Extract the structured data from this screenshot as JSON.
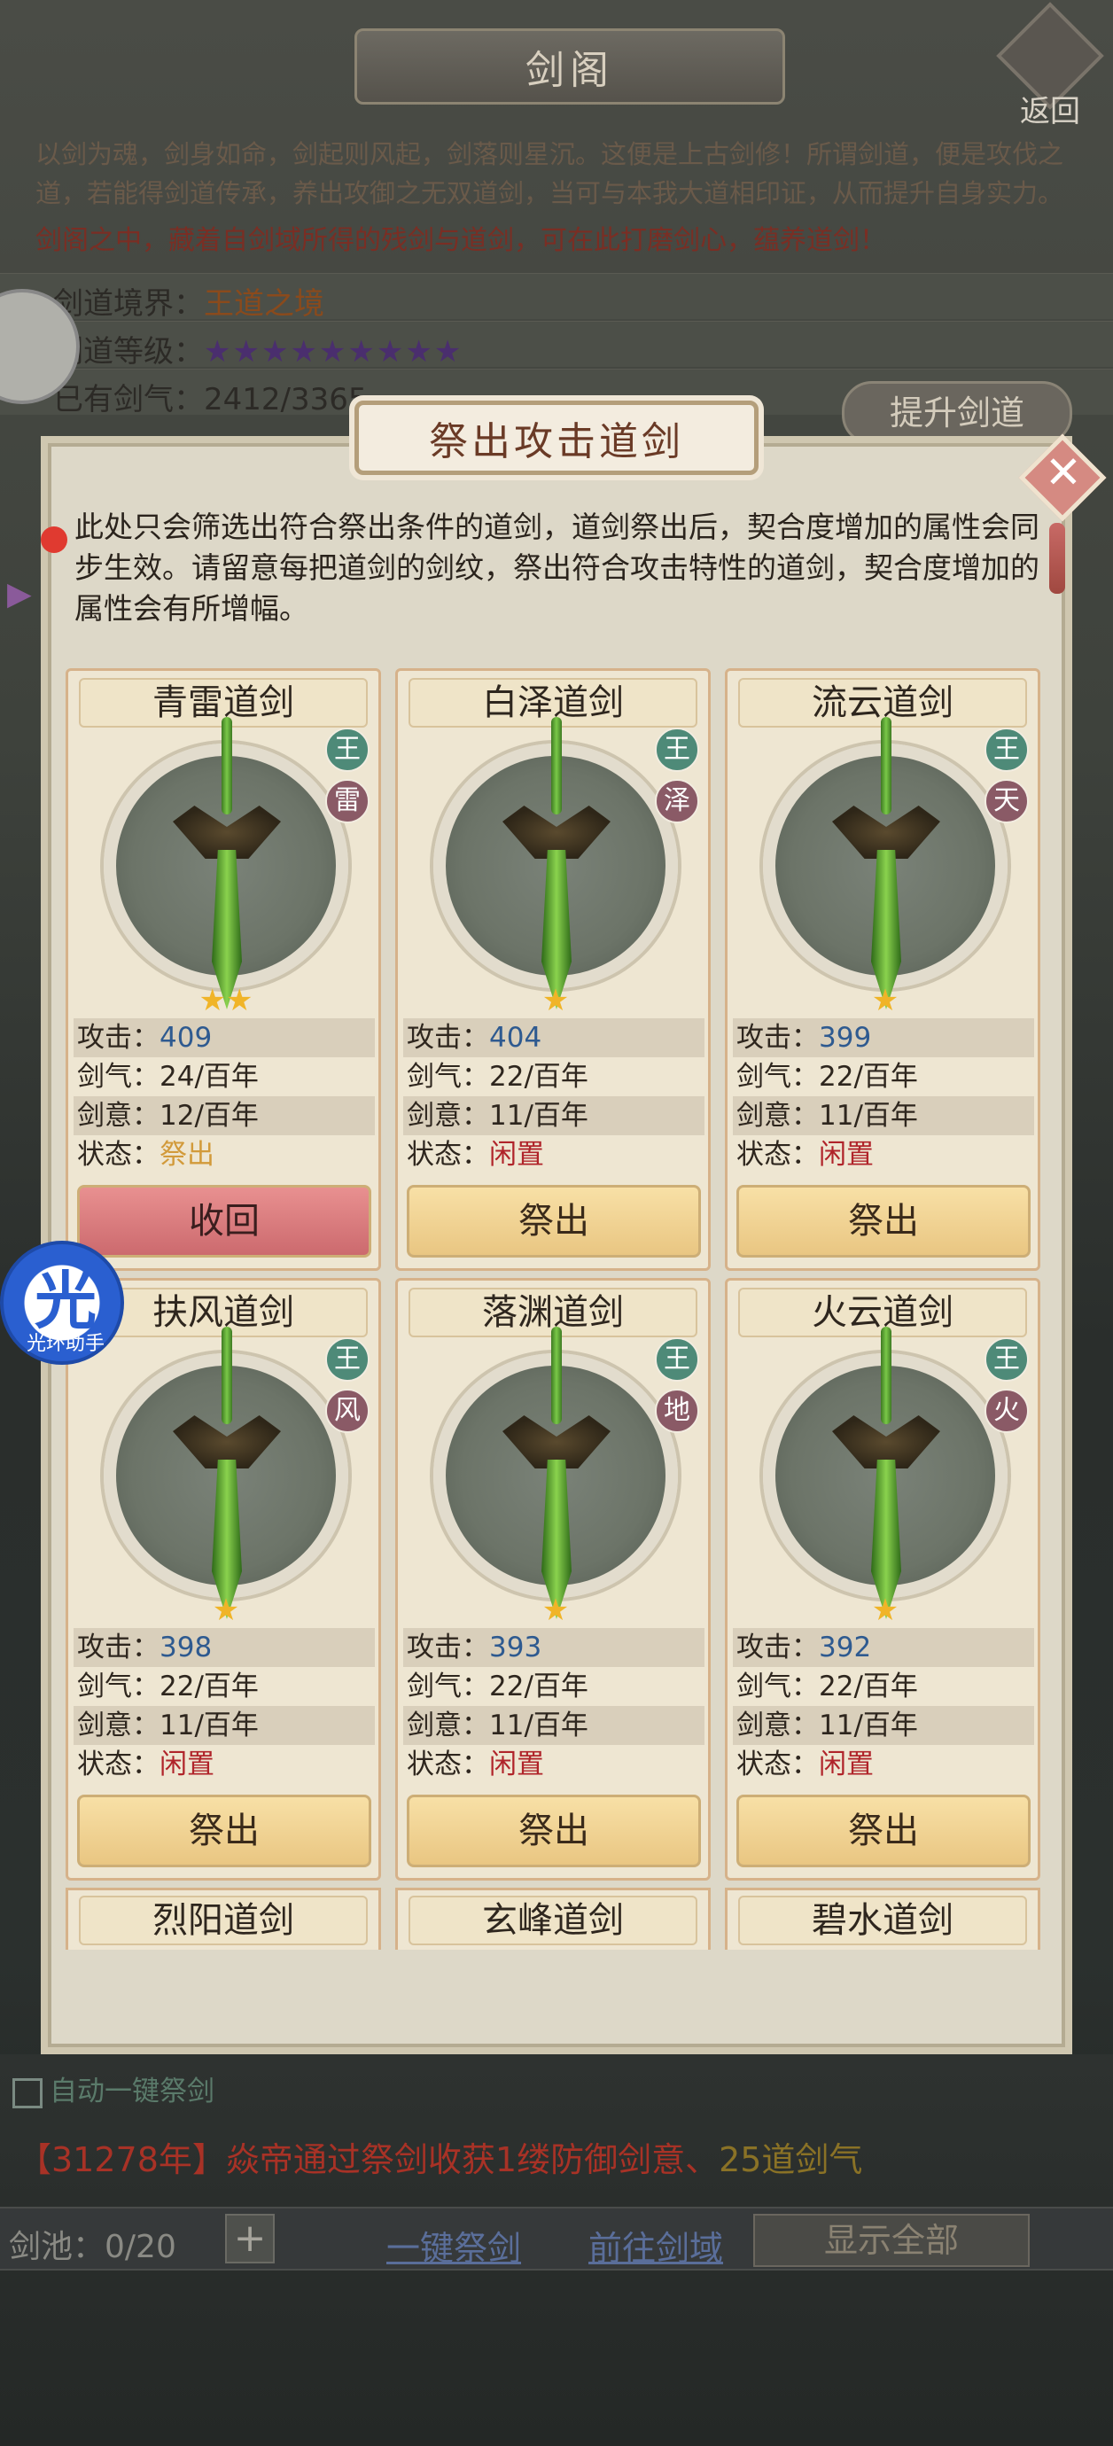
{
  "header": {
    "title": "剑阁",
    "back_label": "返回"
  },
  "intro": {
    "text": "以剑为魂，剑身如命，剑起则风起，剑落则星沉。这便是上古剑修！所谓剑道，便是攻伐之道，若能得剑道传承，养出攻御之无双道剑，当可与本我大道相印证，从而提升自身实力。",
    "red_text": "剑阁之中，藏着自剑域所得的残剑与道剑，可在此打磨剑心，蕴养道剑！"
  },
  "realm": {
    "realm_label": "剑道境界：",
    "realm_value": "王道之境",
    "level_label": "剑道等级：",
    "level_stars": "★★★★★★★★★",
    "qi_label": "已有剑气：",
    "qi_value": "2412/3365",
    "upgrade_label": "提升剑道"
  },
  "dialog": {
    "title": "祭出攻击道剑",
    "description": "此处只会筛选出符合祭出条件的道剑，道剑祭出后，契合度增加的属性会同步生效。请留意每把道剑的剑纹，祭出符合攻击特性的道剑，契合度增加的属性会有所增幅。",
    "labels": {
      "attack": "攻击：",
      "qi": "剑气：",
      "intent": "剑意：",
      "state": "状态："
    },
    "cards": [
      {
        "name": "青雷道剑",
        "badge_rank": "王",
        "badge_element": "雷",
        "stars": "★★",
        "attack": "409",
        "qi": "24/百年",
        "intent": "12/百年",
        "state": "祭出",
        "button": "收回"
      },
      {
        "name": "白泽道剑",
        "badge_rank": "王",
        "badge_element": "泽",
        "stars": "★",
        "attack": "404",
        "qi": "22/百年",
        "intent": "11/百年",
        "state": "闲置",
        "button": "祭出"
      },
      {
        "name": "流云道剑",
        "badge_rank": "王",
        "badge_element": "天",
        "stars": "★",
        "attack": "399",
        "qi": "22/百年",
        "intent": "11/百年",
        "state": "闲置",
        "button": "祭出"
      },
      {
        "name": "扶风道剑",
        "badge_rank": "王",
        "badge_element": "风",
        "stars": "★",
        "attack": "398",
        "qi": "22/百年",
        "intent": "11/百年",
        "state": "闲置",
        "button": "祭出"
      },
      {
        "name": "落渊道剑",
        "badge_rank": "王",
        "badge_element": "地",
        "stars": "★",
        "attack": "393",
        "qi": "22/百年",
        "intent": "11/百年",
        "state": "闲置",
        "button": "祭出"
      },
      {
        "name": "火云道剑",
        "badge_rank": "王",
        "badge_element": "火",
        "stars": "★",
        "attack": "392",
        "qi": "22/百年",
        "intent": "11/百年",
        "state": "闲置",
        "button": "祭出"
      }
    ],
    "partial_cards": [
      "烈阳道剑",
      "玄峰道剑",
      "碧水道剑"
    ]
  },
  "overlay": {
    "assistant_char": "光",
    "assistant_label": "光环助手"
  },
  "bottom": {
    "auto_label": "自动一键祭剑",
    "log_prefix": "【31278年】焱帝通过祭剑收获1",
    "log_mid": "缕防御剑意、",
    "log_highlight": "25道剑气",
    "pool_label": "剑池：0/20",
    "plus": "+",
    "one_click": "一键祭剑",
    "goto_domain": "前往剑域",
    "show_all": "显示全部"
  },
  "colors": {
    "accent_blue": "#2e5a90",
    "state_active": "#d29a3a",
    "state_idle": "#b0242a",
    "recall_button": "#cc6a6e",
    "release_button": "#e9c682"
  }
}
